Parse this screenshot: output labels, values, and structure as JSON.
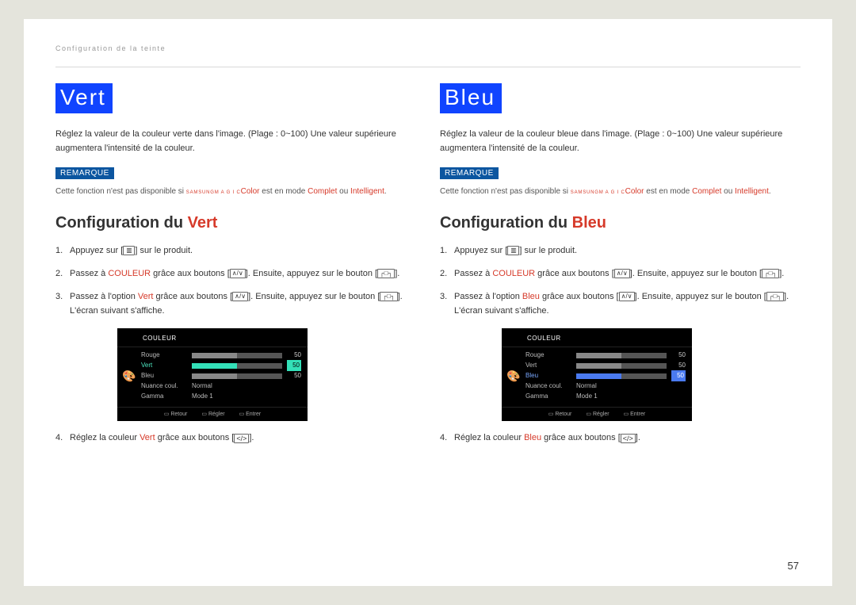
{
  "breadcrumb": "Configuration de la teinte",
  "page_number": "57",
  "remarque_label": "REMARQUE",
  "note_prefix": "Cette fonction n'est pas disponible si ",
  "magic_brand_top": "SAMSUNG",
  "magic_brand_bot": "M A G I C",
  "magic_suffix": "Color",
  "note_mid": " est en mode ",
  "mode_complet": "Complet",
  "note_ou": " ou ",
  "mode_intelligent": "Intelligent",
  "conf_prefix": "Configuration du ",
  "step1_a": "Appuyez sur [",
  "step1_b": "] sur le produit.",
  "step2_a": "Passez à ",
  "couleur_word": "COULEUR",
  "step2_b": " grâce aux boutons [",
  "step2_c": "]. Ensuite, appuyez sur le bouton [",
  "step2_d": "].",
  "step3_a": "Passez à l'option ",
  "step3_b": " grâce aux boutons [",
  "step3_c": "]. Ensuite, appuyez sur le bouton [",
  "step3_d": "]. L'écran suivant s'affiche.",
  "step4_a": "Réglez la couleur ",
  "step4_b": " grâce aux boutons [",
  "step4_c": "].",
  "icon_menu": "▥",
  "icon_updown": "∧/∨",
  "icon_enter": "┌□┐",
  "icon_lr": "</>",
  "left": {
    "title": "Vert",
    "desc": "Réglez la valeur de la couleur verte dans l'image. (Plage : 0~100) Une valeur supérieure augmentera l'intensité de la couleur.",
    "accent_word": "Vert"
  },
  "right": {
    "title": "Bleu",
    "desc": "Réglez la valeur de la couleur bleue dans l'image. (Plage : 0~100) Une valeur supérieure augmentera l'intensité de la couleur.",
    "accent_word": "Bleu"
  },
  "osd": {
    "title": "COULEUR",
    "rows": {
      "rouge": "Rouge",
      "vert": "Vert",
      "bleu": "Bleu",
      "nuance": "Nuance coul.",
      "gamma": "Gamma",
      "normal": "Normal",
      "mode1": "Mode 1"
    },
    "val50": "50",
    "footer": {
      "retour": "Retour",
      "regler": "Régler",
      "entrer": "Entrer"
    }
  }
}
